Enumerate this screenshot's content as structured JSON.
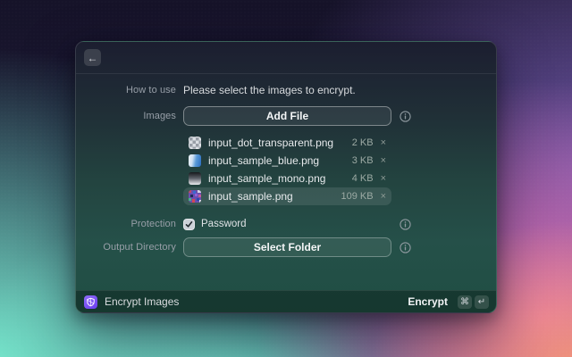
{
  "icons": {
    "back": "←",
    "remove": "×"
  },
  "form": {
    "how_to_use": {
      "label": "How to use",
      "text": "Please select the images to encrypt."
    },
    "images": {
      "label": "Images",
      "add_button": "Add File"
    },
    "files": [
      {
        "name": "input_dot_transparent.png",
        "size": "2 KB"
      },
      {
        "name": "input_sample_blue.png",
        "size": "3 KB"
      },
      {
        "name": "input_sample_mono.png",
        "size": "4 KB"
      },
      {
        "name": "input_sample.png",
        "size": "109 KB",
        "selected": true
      }
    ],
    "protection": {
      "label": "Protection",
      "checkbox_label": "Password",
      "checked": true
    },
    "output_directory": {
      "label": "Output Directory",
      "button": "Select Folder"
    }
  },
  "footer": {
    "app_name": "Encrypt Images",
    "action": "Encrypt",
    "keys": [
      "⌘",
      "↵"
    ]
  },
  "colors": {
    "accent": "#7a52f2",
    "bg_mint": "#7bf2d4",
    "bg_pink": "#e876bc",
    "bg_navy": "#171430",
    "selection": "rgba(255,255,255,0.10)"
  }
}
